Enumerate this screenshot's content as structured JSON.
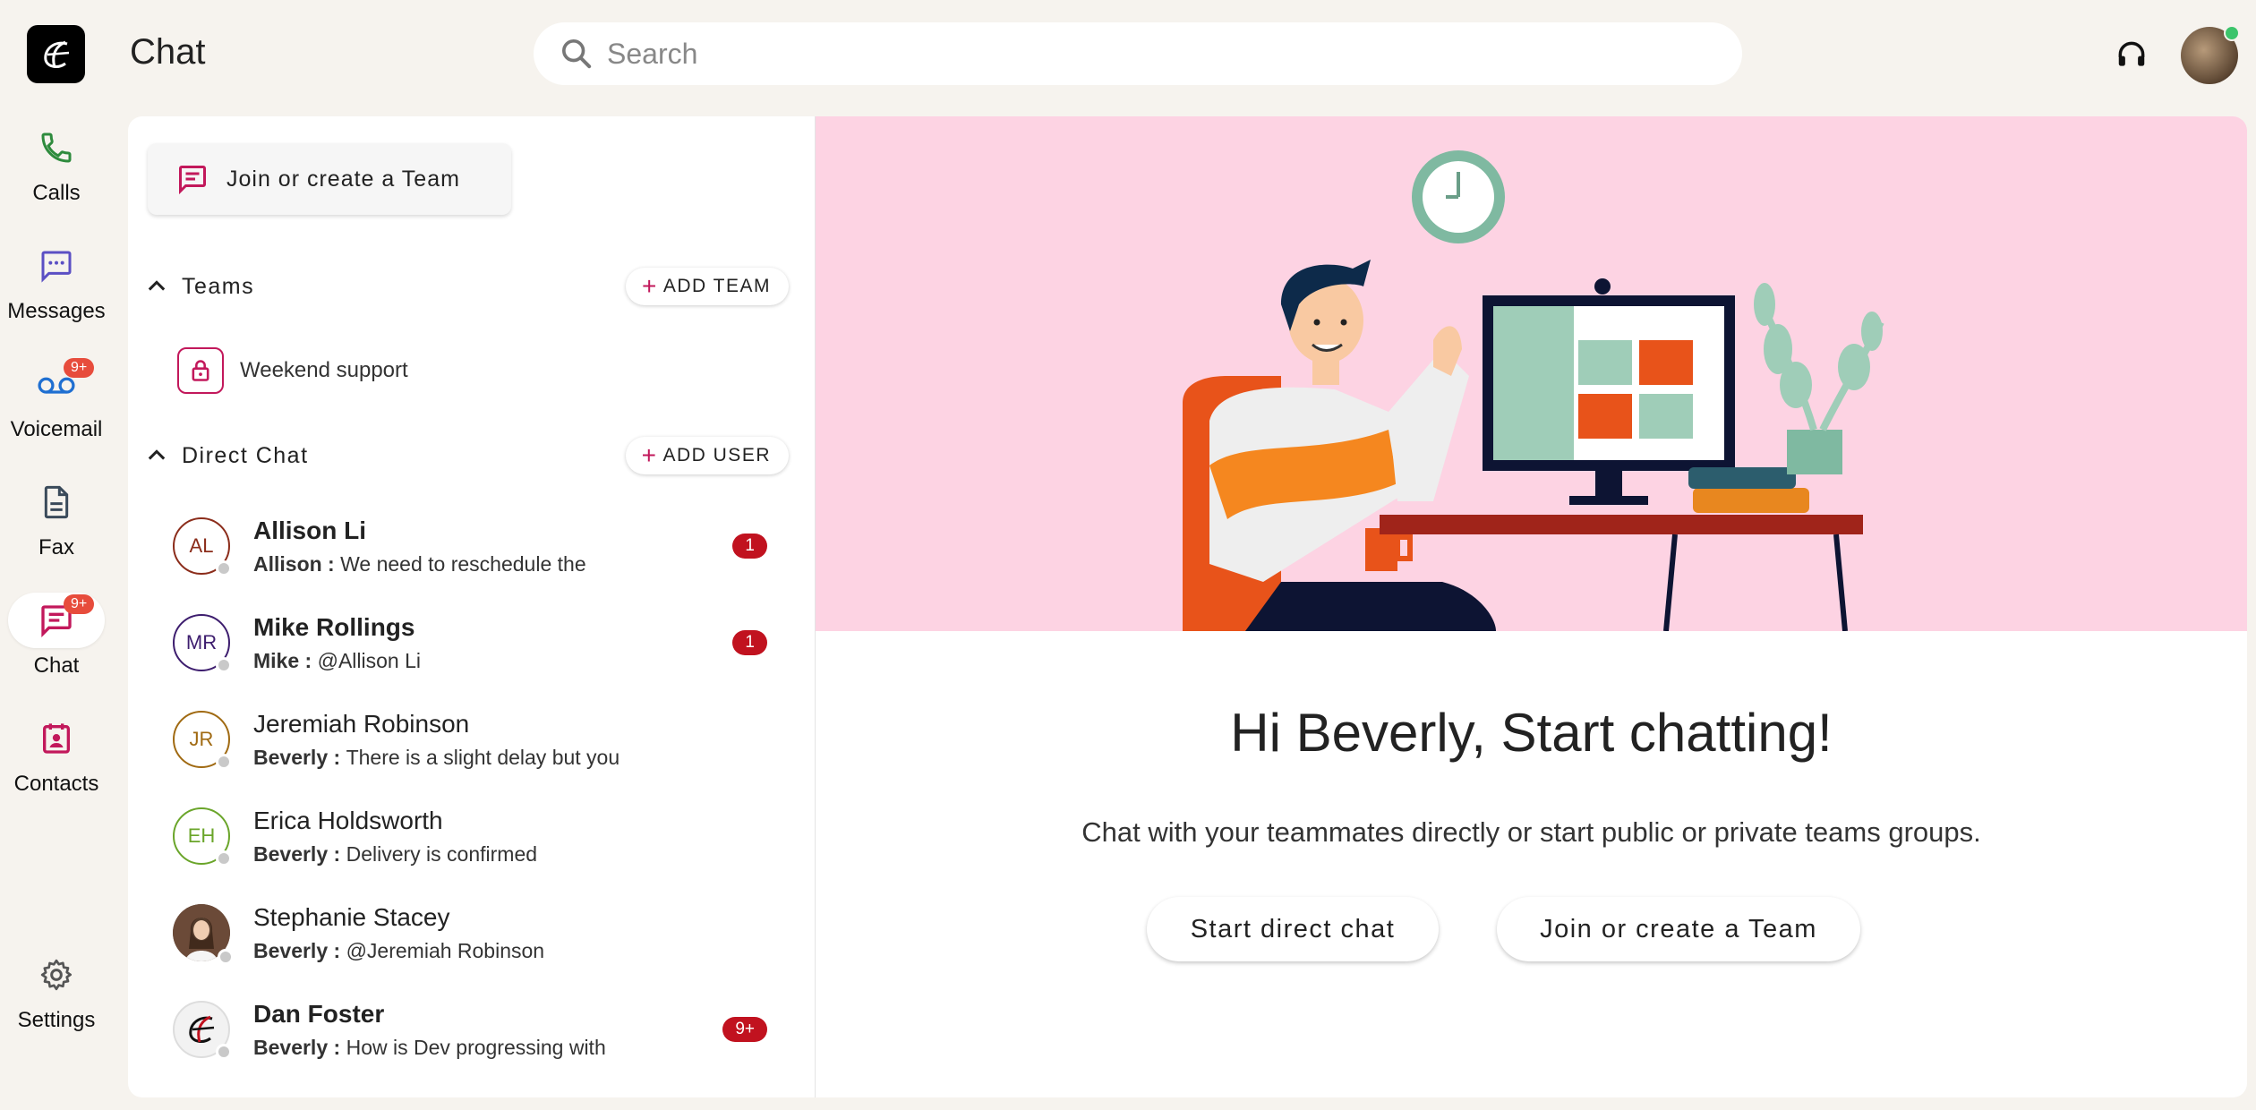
{
  "app": {
    "title": "Chat"
  },
  "search": {
    "placeholder": "Search"
  },
  "rail": {
    "items": [
      {
        "label": "Calls",
        "icon": "phone-icon"
      },
      {
        "label": "Messages",
        "icon": "message-icon"
      },
      {
        "label": "Voicemail",
        "icon": "voicemail-icon",
        "badge": "9+"
      },
      {
        "label": "Fax",
        "icon": "fax-icon"
      },
      {
        "label": "Chat",
        "icon": "chat-icon",
        "badge": "9+",
        "active": true
      },
      {
        "label": "Contacts",
        "icon": "contacts-icon"
      },
      {
        "label": "Settings",
        "icon": "gear-icon"
      }
    ]
  },
  "panel": {
    "join_team_label": "Join or create a Team",
    "teams_title": "Teams",
    "add_team_label": "ADD TEAM",
    "teams": [
      {
        "name": "Weekend support",
        "icon": "lock-icon"
      }
    ],
    "direct_title": "Direct Chat",
    "add_user_label": "ADD USER",
    "chats": [
      {
        "initials": "AL",
        "name": "Allison Li",
        "sender": "Allison",
        "preview": "We need to reschedule the",
        "badge": "1",
        "unread": true,
        "color": "#8b2c1a"
      },
      {
        "initials": "MR",
        "name": "Mike Rollings",
        "sender": "Mike",
        "preview": "@Allison Li",
        "badge": "1",
        "unread": true,
        "color": "#3d1d6e"
      },
      {
        "initials": "JR",
        "name": "Jeremiah Robinson",
        "sender": "Beverly",
        "preview": "There is a slight delay but you",
        "badge": "",
        "unread": false,
        "color": "#a06a12"
      },
      {
        "initials": "EH",
        "name": "Erica Holdsworth",
        "sender": "Beverly",
        "preview": "Delivery is confirmed",
        "badge": "",
        "unread": false,
        "color": "#6aa52a"
      },
      {
        "initials": "",
        "name": "Stephanie Stacey",
        "sender": "Beverly",
        "preview": "@Jeremiah Robinson",
        "badge": "",
        "unread": false,
        "color": "#999999"
      },
      {
        "initials": "",
        "name": "Dan Foster",
        "sender": "Beverly",
        "preview": "How is Dev progressing with",
        "badge": "9+",
        "unread": true,
        "color": "#dddddd"
      }
    ]
  },
  "main": {
    "greeting": "Hi Beverly, Start chatting!",
    "subtext": "Chat with your teammates directly or start public or private teams groups.",
    "start_direct_label": "Start direct chat",
    "join_team_label": "Join or create a Team"
  },
  "colors": {
    "accent": "#c2185b",
    "badge": "#c1121f",
    "hero_bg": "#fdd3e3",
    "rail_bg": "#f6f3ee"
  }
}
